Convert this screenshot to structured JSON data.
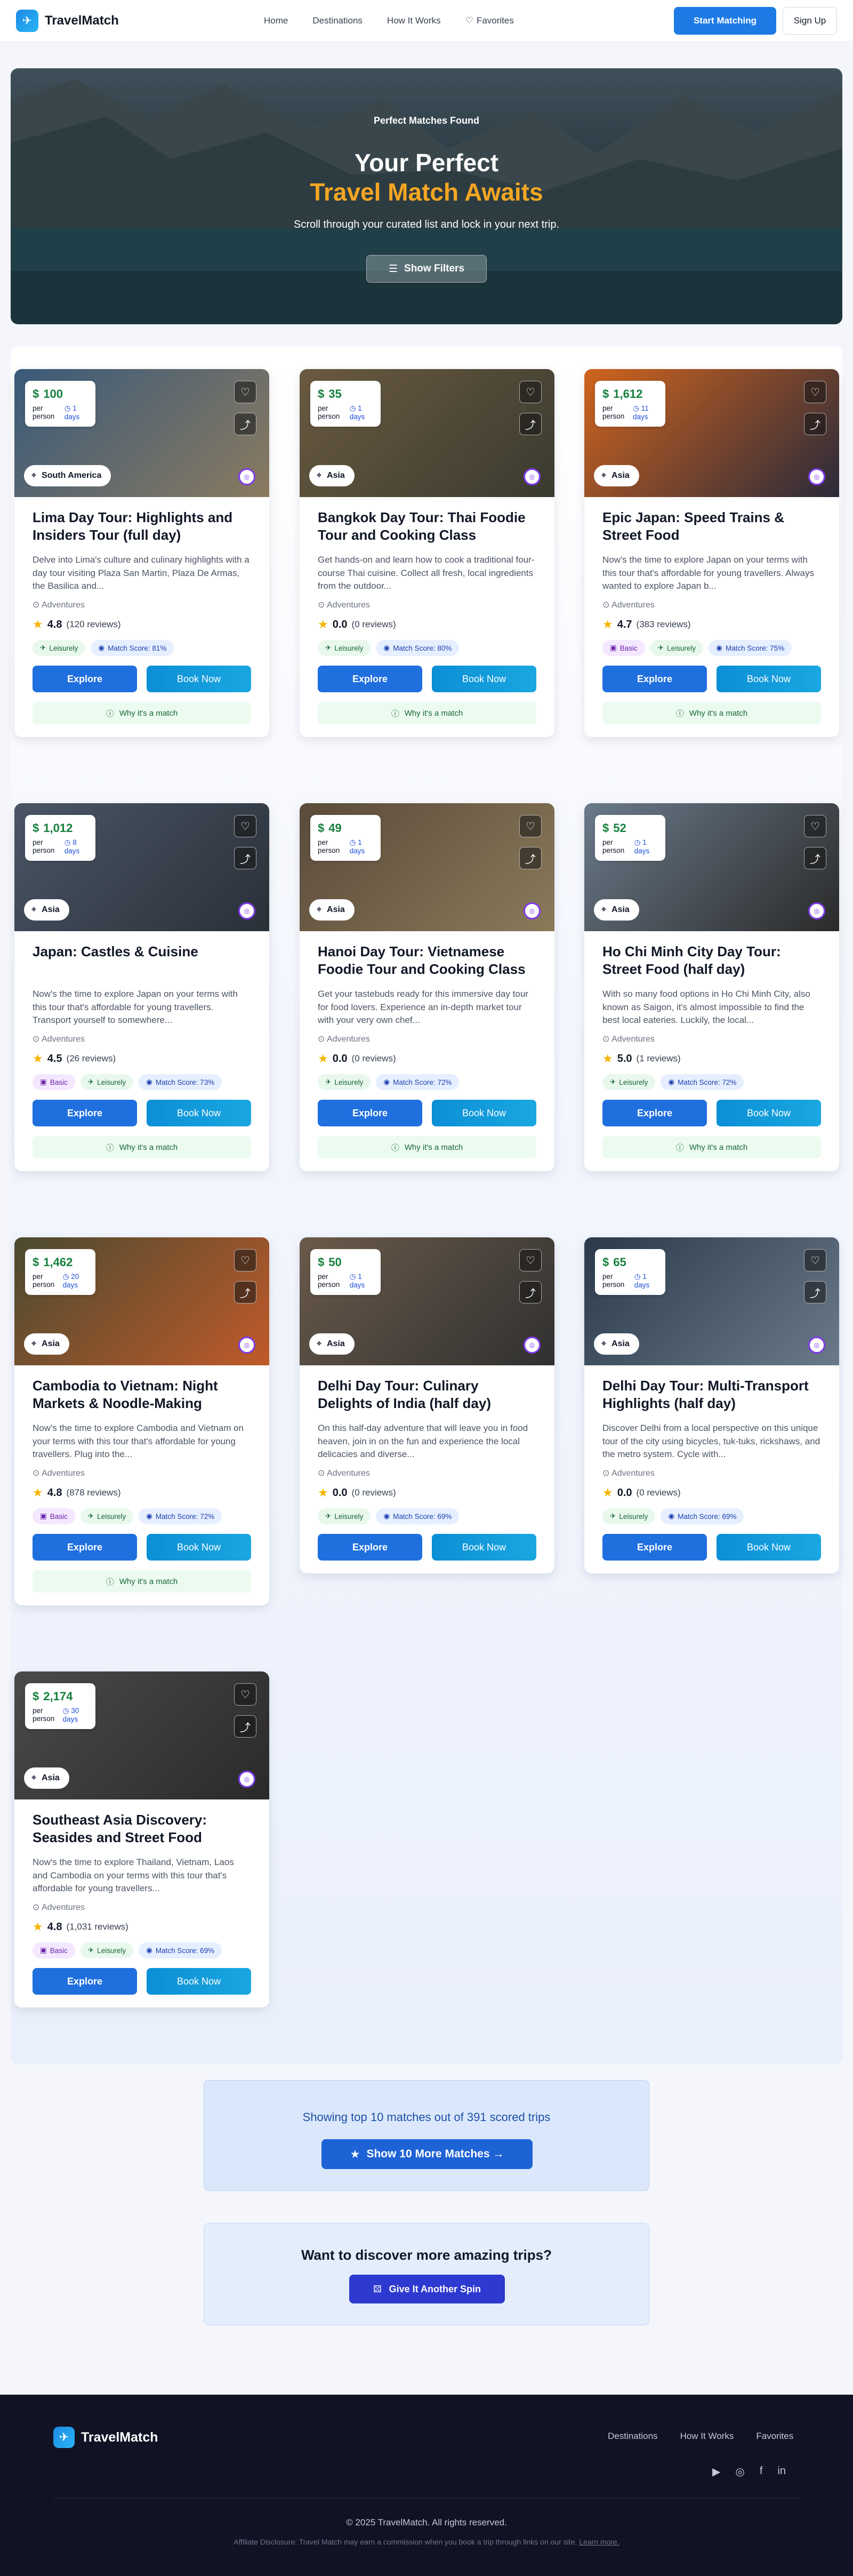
{
  "header": {
    "logo_text": "TravelMatch",
    "nav": [
      "Home",
      "Destinations",
      "How It Works",
      "Favorites"
    ],
    "start_matching": "Start Matching",
    "sign_up": "Sign Up"
  },
  "hero": {
    "kicker": "Perfect Matches Found",
    "title_line1": "Your Perfect",
    "title_line2": "Travel Match Awaits",
    "subtitle": "Scroll through your curated list and lock in your next trip.",
    "filters_button": "Show Filters"
  },
  "cards": [
    {
      "price": "100",
      "per": "per person",
      "days": "1 days",
      "region": "South America",
      "title": "Lima Day Tour: Highlights and Insiders Tour (full day)",
      "desc": "Delve into Lima's culture and culinary highlights with a day tour visiting Plaza San Martin, Plaza De Armas, the Basilica and...",
      "category": "Adventures",
      "rating": "4.8",
      "reviews": "(120 reviews)",
      "tags": [
        {
          "type": "leisure",
          "label": "Leisurely"
        },
        {
          "type": "match",
          "label": "Match Score: 81%"
        }
      ],
      "explore": "Explore",
      "book": "Book Now",
      "why": "Why it's a match"
    },
    {
      "price": "35",
      "per": "per person",
      "days": "1 days",
      "region": "Asia",
      "title": "Bangkok Day Tour: Thai Foodie Tour and Cooking Class",
      "desc": "Get hands-on and learn how to cook a traditional four-course Thai cuisine. Collect all fresh, local ingredients from the outdoor...",
      "category": "Adventures",
      "rating": "0.0",
      "reviews": "(0 reviews)",
      "tags": [
        {
          "type": "leisure",
          "label": "Leisurely"
        },
        {
          "type": "match",
          "label": "Match Score: 80%"
        }
      ],
      "explore": "Explore",
      "book": "Book Now",
      "why": "Why it's a match"
    },
    {
      "price": "1,612",
      "per": "per person",
      "days": "11 days",
      "region": "Asia",
      "title": "Epic Japan: Speed Trains & Street Food",
      "desc": "Now's the time to explore Japan on your terms with this tour that's affordable for young travellers. Always wanted to explore Japan b...",
      "category": "Adventures",
      "rating": "4.7",
      "reviews": "(383 reviews)",
      "tags": [
        {
          "type": "basic",
          "label": "Basic"
        },
        {
          "type": "leisure",
          "label": "Leisurely"
        },
        {
          "type": "match",
          "label": "Match Score: 75%"
        }
      ],
      "explore": "Explore",
      "book": "Book Now",
      "why": "Why it's a match"
    },
    {
      "price": "1,012",
      "per": "per person",
      "days": "8 days",
      "region": "Asia",
      "title": "Japan: Castles & Cuisine",
      "desc": "Now's the time to explore Japan on your terms with this tour that's affordable for young travellers. Transport yourself to somewhere...",
      "category": "Adventures",
      "rating": "4.5",
      "reviews": "(26 reviews)",
      "tags": [
        {
          "type": "basic",
          "label": "Basic"
        },
        {
          "type": "leisure",
          "label": "Leisurely"
        },
        {
          "type": "match",
          "label": "Match Score: 73%"
        }
      ],
      "explore": "Explore",
      "book": "Book Now",
      "why": "Why it's a match"
    },
    {
      "price": "49",
      "per": "per person",
      "days": "1 days",
      "region": "Asia",
      "title": "Hanoi Day Tour: Vietnamese Foodie Tour and Cooking Class",
      "desc": "Get your tastebuds ready for this immersive day tour for food lovers. Experience an in-depth market tour with your very own chef...",
      "category": "Adventures",
      "rating": "0.0",
      "reviews": "(0 reviews)",
      "tags": [
        {
          "type": "leisure",
          "label": "Leisurely"
        },
        {
          "type": "match",
          "label": "Match Score: 72%"
        }
      ],
      "explore": "Explore",
      "book": "Book Now",
      "why": "Why it's a match"
    },
    {
      "price": "52",
      "per": "per person",
      "days": "1 days",
      "region": "Asia",
      "title": "Ho Chi Minh City Day Tour: Street Food (half day)",
      "desc": "With so many food options in Ho Chi Minh City, also known as Saigon, it's almost impossible to find the best local eateries. Luckily, the local...",
      "category": "Adventures",
      "rating": "5.0",
      "reviews": "(1 reviews)",
      "tags": [
        {
          "type": "leisure",
          "label": "Leisurely"
        },
        {
          "type": "match",
          "label": "Match Score: 72%"
        }
      ],
      "explore": "Explore",
      "book": "Book Now",
      "why": "Why it's a match"
    },
    {
      "price": "1,462",
      "per": "per person",
      "days": "20 days",
      "region": "Asia",
      "title": "Cambodia to Vietnam: Night Markets & Noodle-Making",
      "desc": "Now's the time to explore Cambodia and Vietnam on your terms with this tour that's affordable for young travellers. Plug into the...",
      "category": "Adventures",
      "rating": "4.8",
      "reviews": "(878 reviews)",
      "tags": [
        {
          "type": "basic",
          "label": "Basic"
        },
        {
          "type": "leisure",
          "label": "Leisurely"
        },
        {
          "type": "match",
          "label": "Match Score: 72%"
        }
      ],
      "explore": "Explore",
      "book": "Book Now",
      "why": "Why it's a match"
    },
    {
      "price": "50",
      "per": "per person",
      "days": "1 days",
      "region": "Asia",
      "title": "Delhi Day Tour: Culinary Delights of India (half day)",
      "desc": "On this half-day adventure that will leave you in food heaven, join in on the fun and experience the local delicacies and diverse...",
      "category": "Adventures",
      "rating": "0.0",
      "reviews": "(0 reviews)",
      "tags": [
        {
          "type": "leisure",
          "label": "Leisurely"
        },
        {
          "type": "match",
          "label": "Match Score: 69%"
        }
      ],
      "explore": "Explore",
      "book": "Book Now",
      "why": ""
    },
    {
      "price": "65",
      "per": "per person",
      "days": "1 days",
      "region": "Asia",
      "title": "Delhi Day Tour: Multi-Transport Highlights (half day)",
      "desc": "Discover Delhi from a local perspective on this unique tour of the city using bicycles, tuk-tuks, rickshaws, and the metro system. Cycle with...",
      "category": "Adventures",
      "rating": "0.0",
      "reviews": "(0 reviews)",
      "tags": [
        {
          "type": "leisure",
          "label": "Leisurely"
        },
        {
          "type": "match",
          "label": "Match Score: 69%"
        }
      ],
      "explore": "Explore",
      "book": "Book Now",
      "why": ""
    },
    {
      "price": "2,174",
      "per": "per person",
      "days": "30 days",
      "region": "Asia",
      "title": "Southeast Asia Discovery: Seasides and Street Food",
      "desc": "Now's the time to explore Thailand, Vietnam, Laos and Cambodia on your terms with this tour that's affordable for young travellers...",
      "category": "Adventures",
      "rating": "4.8",
      "reviews": "(1,031 reviews)",
      "tags": [
        {
          "type": "basic",
          "label": "Basic"
        },
        {
          "type": "leisure",
          "label": "Leisurely"
        },
        {
          "type": "match",
          "label": "Match Score: 69%"
        }
      ],
      "explore": "Explore",
      "book": "Book Now",
      "why": ""
    }
  ],
  "more": {
    "text": "Showing top 10 matches out of 391 scored trips",
    "button": "Show 10 More Matches →"
  },
  "spin": {
    "text": "Want to discover more amazing trips?",
    "button": "Give It Another Spin"
  },
  "footer": {
    "logo_text": "TravelMatch",
    "nav": [
      "Destinations",
      "How It Works",
      "Favorites"
    ],
    "copyright": "© 2025 TravelMatch. All rights reserved.",
    "disclosure": "Affiliate Disclosure: Travel Match may earn a commission when you book a trip through links on our site.",
    "learn_more": "Learn more."
  },
  "colors": {
    "accent": "#1e7be6",
    "price": "#15803d",
    "highlight": "#f5a623"
  }
}
